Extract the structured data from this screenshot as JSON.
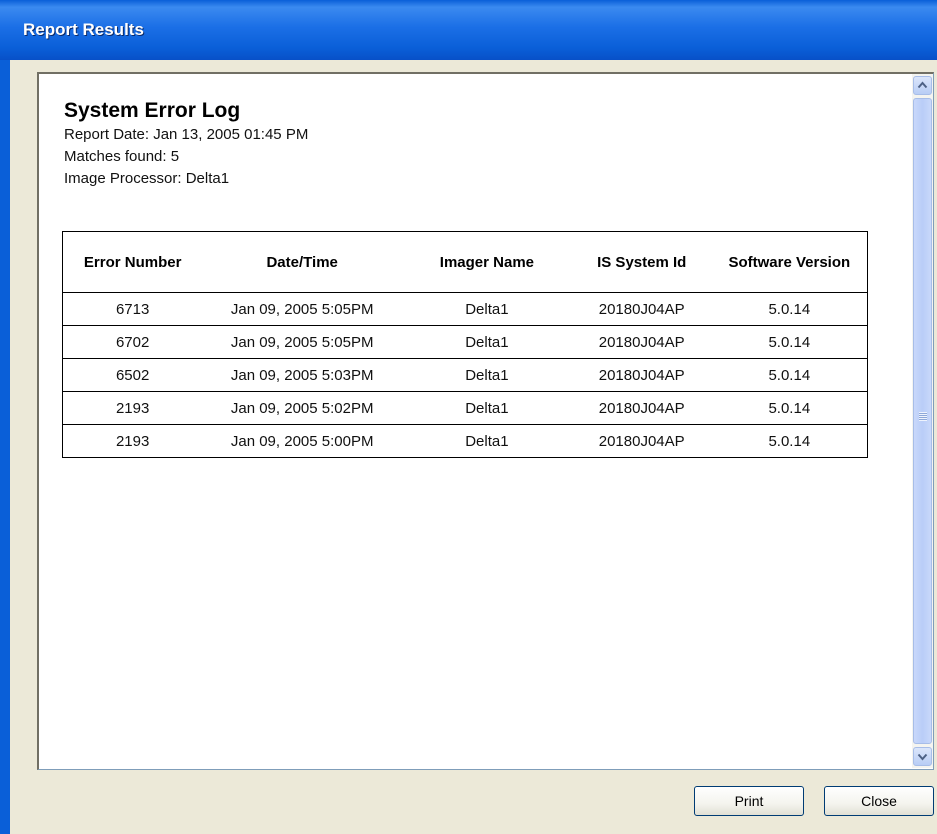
{
  "window": {
    "title": "Report Results"
  },
  "report": {
    "title": "System Error Log",
    "report_date": "Report Date: Jan 13, 2005 01:45 PM",
    "matches": "Matches found: 5",
    "image_processor": "Image Processor: Delta1"
  },
  "table": {
    "headers": [
      "Error Number",
      "Date/Time",
      "Imager Name",
      "IS System Id",
      "Software Version"
    ],
    "rows": [
      [
        "6713",
        "Jan 09, 2005 5:05PM",
        "Delta1",
        "20180J04AP",
        "5.0.14"
      ],
      [
        "6702",
        "Jan 09, 2005 5:05PM",
        "Delta1",
        "20180J04AP",
        "5.0.14"
      ],
      [
        "6502",
        "Jan 09, 2005 5:03PM",
        "Delta1",
        "20180J04AP",
        "5.0.14"
      ],
      [
        "2193",
        "Jan 09, 2005 5:02PM",
        "Delta1",
        "20180J04AP",
        "5.0.14"
      ],
      [
        "2193",
        "Jan 09, 2005 5:00PM",
        "Delta1",
        "20180J04AP",
        "5.0.14"
      ]
    ]
  },
  "buttons": {
    "print": "Print",
    "close": "Close"
  },
  "icons": {
    "scroll_up": "chevron-up-icon",
    "scroll_down": "chevron-down-icon",
    "thumb_grip": "grip-icon"
  },
  "colors": {
    "title_bar": "#0a5fd8",
    "dialog_bg": "#ece9d8",
    "scroll_thumb": "#b9cdf8"
  }
}
